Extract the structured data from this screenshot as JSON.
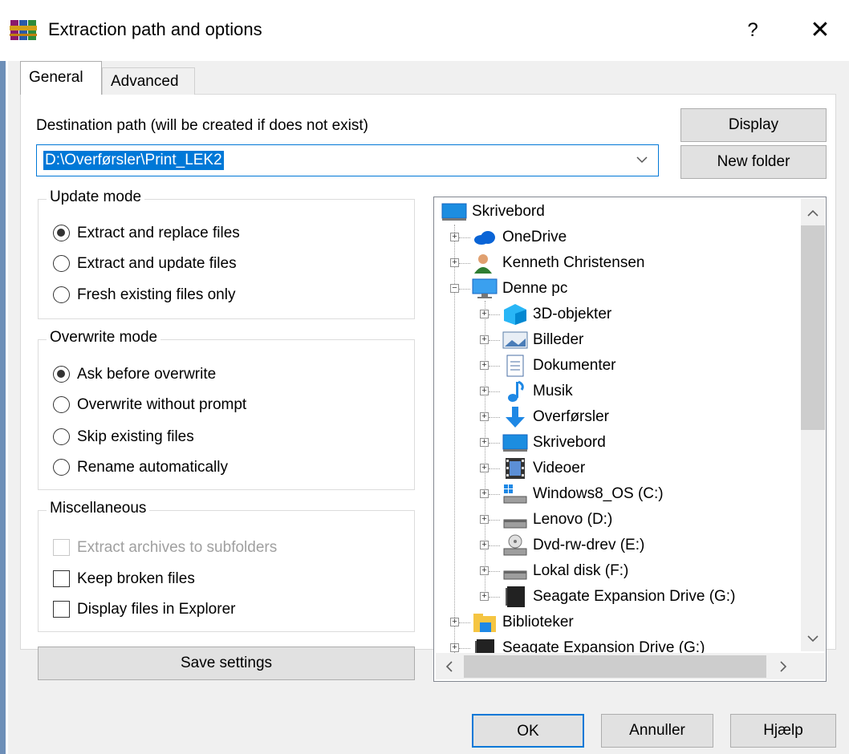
{
  "window": {
    "title": "Extraction path and options",
    "help_glyph": "?",
    "close_glyph": "✕"
  },
  "tabs": [
    {
      "label": "General",
      "selected": true
    },
    {
      "label": "Advanced",
      "selected": false
    }
  ],
  "destination": {
    "label": "Destination path (will be created if does not exist)",
    "value": "D:\\Overførsler\\Print_LEK2"
  },
  "buttons": {
    "display": "Display",
    "new_folder": "New folder",
    "save_settings": "Save settings",
    "ok": "OK",
    "cancel": "Annuller",
    "help": "Hjælp"
  },
  "update_mode": {
    "legend": "Update mode",
    "options": [
      {
        "label": "Extract and replace files",
        "selected": true
      },
      {
        "label": "Extract and update files",
        "selected": false
      },
      {
        "label": "Fresh existing files only",
        "selected": false
      }
    ]
  },
  "overwrite_mode": {
    "legend": "Overwrite mode",
    "options": [
      {
        "label": "Ask before overwrite",
        "selected": true
      },
      {
        "label": "Overwrite without prompt",
        "selected": false
      },
      {
        "label": "Skip existing files",
        "selected": false
      },
      {
        "label": "Rename automatically",
        "selected": false
      }
    ]
  },
  "misc": {
    "legend": "Miscellaneous",
    "options": [
      {
        "label": "Extract archives to subfolders",
        "checked": false,
        "disabled": true
      },
      {
        "label": "Keep broken files",
        "checked": false,
        "disabled": false
      },
      {
        "label": "Display files in Explorer",
        "checked": false,
        "disabled": false
      }
    ]
  },
  "tree": {
    "items": [
      {
        "label": "Skrivebord",
        "icon": "desktop-icon"
      },
      {
        "label": "OneDrive",
        "icon": "cloud-icon"
      },
      {
        "label": "Kenneth Christensen",
        "icon": "user-icon"
      },
      {
        "label": "Denne pc",
        "icon": "computer-icon"
      },
      {
        "label": "3D-objekter",
        "icon": "cube-icon"
      },
      {
        "label": "Billeder",
        "icon": "pictures-icon"
      },
      {
        "label": "Dokumenter",
        "icon": "document-icon"
      },
      {
        "label": "Musik",
        "icon": "music-icon"
      },
      {
        "label": "Overførsler",
        "icon": "download-icon"
      },
      {
        "label": "Skrivebord",
        "icon": "desktop-icon"
      },
      {
        "label": "Videoer",
        "icon": "video-icon"
      },
      {
        "label": "Windows8_OS (C:)",
        "icon": "windows-drive-icon"
      },
      {
        "label": "Lenovo (D:)",
        "icon": "drive-icon"
      },
      {
        "label": "Dvd-rw-drev (E:)",
        "icon": "dvd-drive-icon"
      },
      {
        "label": "Lokal disk (F:)",
        "icon": "drive-icon"
      },
      {
        "label": "Seagate Expansion Drive (G:)",
        "icon": "external-drive-icon"
      },
      {
        "label": "Biblioteker",
        "icon": "libraries-icon"
      },
      {
        "label": "Seagate Expansion Drive (G:)",
        "icon": "external-drive-icon"
      }
    ]
  },
  "colors": {
    "accent": "#0078d7",
    "button_face": "#e1e1e1",
    "dialog_bg": "#f0f0f0"
  }
}
